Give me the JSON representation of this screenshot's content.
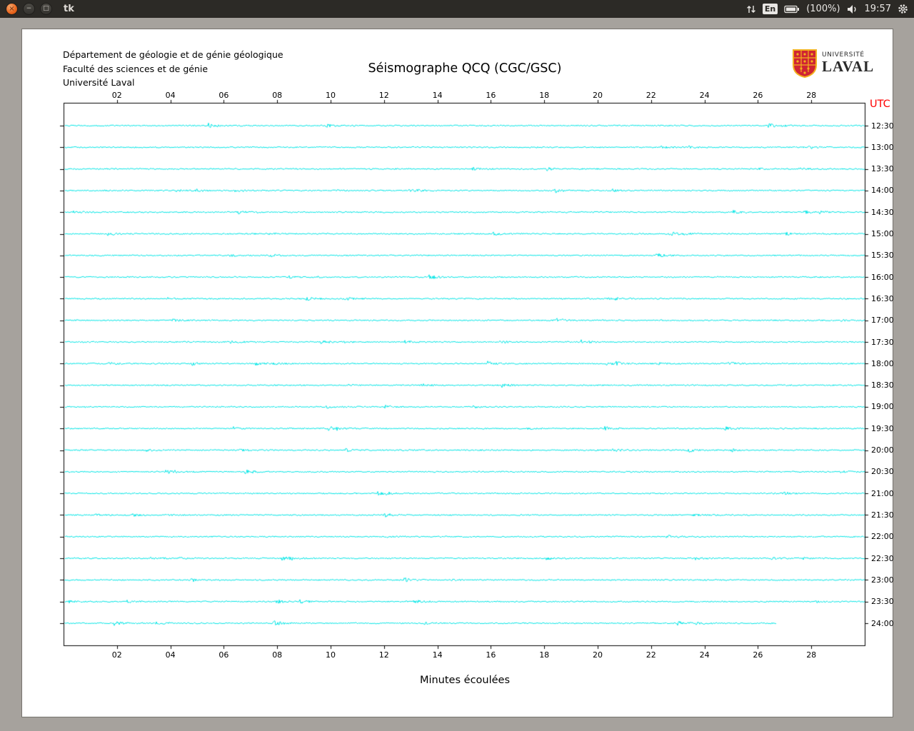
{
  "desktop": {
    "window_title": "tk",
    "tray": {
      "keyboard": "En",
      "battery": "(100%)",
      "time": "19:57"
    }
  },
  "app": {
    "header_lines": [
      "Département de géologie et de génie géologique",
      "Faculté des sciences et de génie",
      "Université Laval"
    ],
    "title": "Séismographe QCQ (CGC/GSC)",
    "logo": {
      "top": "UNIVERSITÉ",
      "name": "LAVAL"
    },
    "utc_axis_label": "UTC",
    "x_axis_label": "Minutes écoulées"
  },
  "chart_data": {
    "type": "line",
    "subtype": "helicorder-seismogram",
    "title": "Séismographe QCQ (CGC/GSC)",
    "xlabel": "Minutes écoulées",
    "x_min": 0,
    "x_max": 30,
    "x_ticks": [
      "02",
      "04",
      "06",
      "08",
      "10",
      "12",
      "14",
      "16",
      "18",
      "20",
      "22",
      "24",
      "26",
      "28"
    ],
    "x_tick_values": [
      2,
      4,
      6,
      8,
      10,
      12,
      14,
      16,
      18,
      20,
      22,
      24,
      26,
      28
    ],
    "right_axis_label": "UTC",
    "right_axis_label_color": "#ff0000",
    "utc_labels": [
      "12:30",
      "13:00",
      "13:30",
      "14:00",
      "14:30",
      "15:00",
      "15:30",
      "16:00",
      "16:30",
      "17:00",
      "17:30",
      "18:00",
      "18:30",
      "19:00",
      "19:30",
      "20:00",
      "20:30",
      "21:00",
      "21:30",
      "22:00",
      "22:30",
      "23:00",
      "23:30",
      "24:00"
    ],
    "trace_count": 24,
    "minutes_per_trace": 30,
    "trace_color": "#00E5E5",
    "last_trace_end_minute": 26.7,
    "description": "24 half-hour rows of continuous low-amplitude background seismic noise; no large events, occasional small bursts; final row (24:00) recording stops near minute 26.7",
    "grid": false,
    "legend": "none"
  }
}
